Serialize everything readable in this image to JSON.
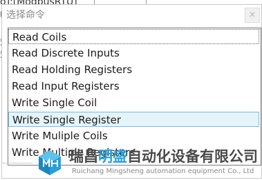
{
  "background": {
    "top_text": "o]:[ModbusRTU]",
    "left_fragment_1": "U",
    "left_fragment_2": "5",
    "left_fragment_3": "5"
  },
  "dialog": {
    "title": "选择命令",
    "close_glyph": "×"
  },
  "commands": [
    {
      "label": "Read Coils"
    },
    {
      "label": "Read Discrete Inputs"
    },
    {
      "label": "Read Holding Registers"
    },
    {
      "label": "Read Input Registers"
    },
    {
      "label": "Write Single Coil"
    },
    {
      "label": "Write Single Register"
    },
    {
      "label": "Write Muliple Coils"
    },
    {
      "label": "Write Multiple Registers"
    }
  ],
  "list_state": {
    "focused_item": "Read Coils",
    "hover_item": "Write Single Register",
    "hover_color": "#e5f3fb",
    "hover_border_color": "#70c0e7"
  },
  "watermark": {
    "cn_part1": "瑞昌",
    "cn_part2": "明盛",
    "cn_part3": "自动化设备有限公司",
    "en": "Ruichang Mingsheng automation equipment Co., Ltd",
    "accent_color": "#2a9fd8",
    "logo_icon": "cube-logo-icon"
  }
}
